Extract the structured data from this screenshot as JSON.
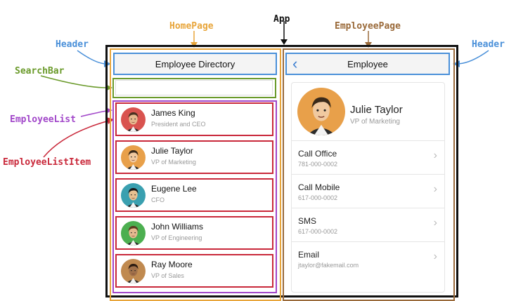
{
  "annotations": {
    "app": "App",
    "homepage": "HomePage",
    "employeepage": "EmployeePage",
    "header_left": "Header",
    "header_right": "Header",
    "searchbar": "SearchBar",
    "employeelist": "EmployeeList",
    "employeelistitem": "EmployeeListItem"
  },
  "colors": {
    "app": "#111111",
    "homepage": "#e8a53a",
    "employeepage": "#9a6a3a",
    "header": "#4a90d9",
    "searchbar": "#6a9a2a",
    "employeelist": "#a146c9",
    "employeelistitem": "#c9283a"
  },
  "home": {
    "header_title": "Employee Directory",
    "employees": [
      {
        "name": "James King",
        "title": "President and CEO",
        "avatar_bg": "#d9534f",
        "skin": "#e6b98f",
        "hair": "#4a3020"
      },
      {
        "name": "Julie Taylor",
        "title": "VP of Marketing",
        "avatar_bg": "#e8a04a",
        "skin": "#f0c9a0",
        "hair": "#3a2a1a"
      },
      {
        "name": "Eugene Lee",
        "title": "CFO",
        "avatar_bg": "#3aa0b0",
        "skin": "#e8c090",
        "hair": "#1a1a1a"
      },
      {
        "name": "John Williams",
        "title": "VP of Engineering",
        "avatar_bg": "#4caf50",
        "skin": "#e6b98f",
        "hair": "#5a3a20"
      },
      {
        "name": "Ray Moore",
        "title": "VP of Sales",
        "avatar_bg": "#c08a50",
        "skin": "#a0704a",
        "hair": "#2a1a10"
      }
    ]
  },
  "employee": {
    "header_title": "Employee",
    "back_icon": "chevron-left-icon",
    "name": "Julie Taylor",
    "title": "VP of Marketing",
    "actions": [
      {
        "label": "Call Office",
        "value": "781-000-0002"
      },
      {
        "label": "Call Mobile",
        "value": "617-000-0002"
      },
      {
        "label": "SMS",
        "value": "617-000-0002"
      },
      {
        "label": "Email",
        "value": "jtaylor@fakemail.com"
      }
    ]
  }
}
